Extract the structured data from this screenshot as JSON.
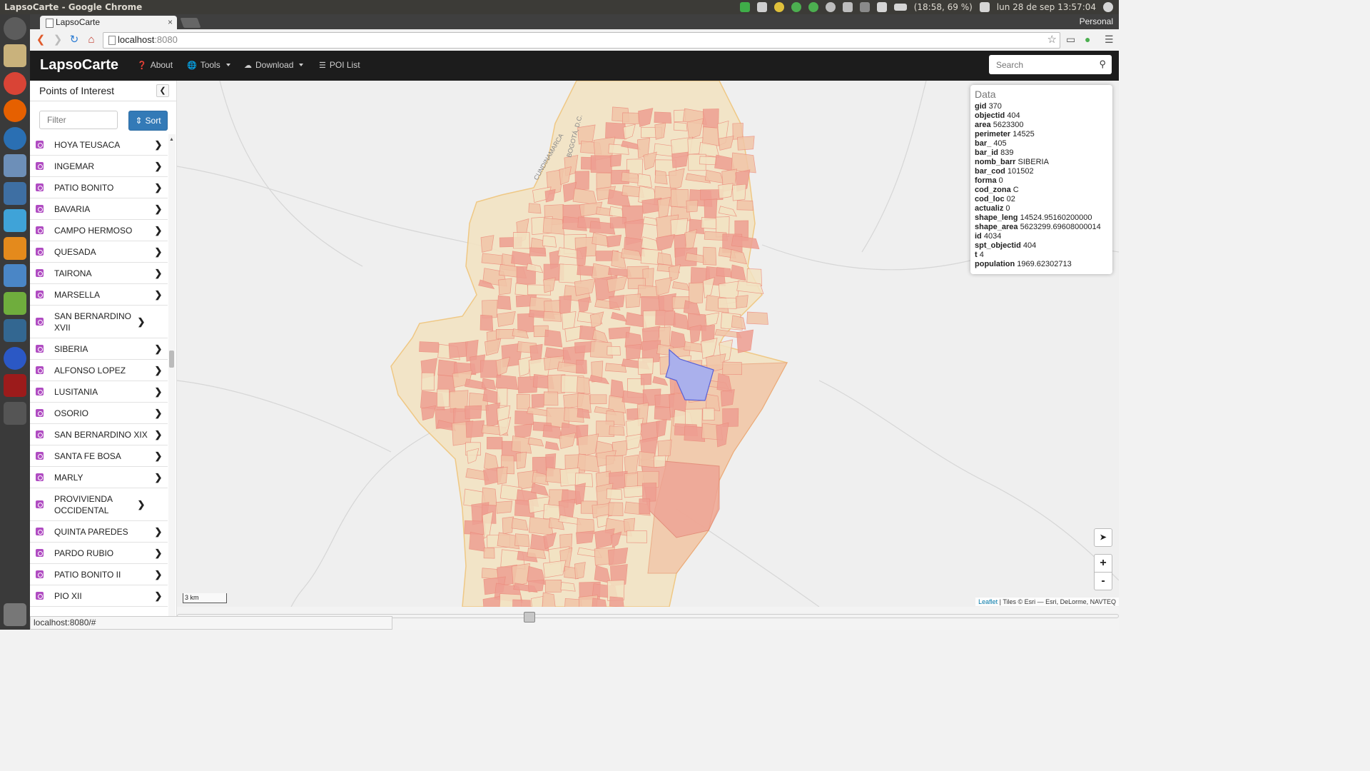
{
  "os": {
    "window_title": "LapsoCarte - Google Chrome",
    "battery": "(18:58, 69 %)",
    "clock": "lun 28 de sep 13:57:04",
    "profile": "Personal"
  },
  "browser": {
    "tab_title": "LapsoCarte",
    "tab_close": "×",
    "url_host": "localhost",
    "url_port": ":8080",
    "status_url": "localhost:8080/#"
  },
  "navbar": {
    "brand": "LapsoCarte",
    "about": "About",
    "tools": "Tools",
    "download": "Download",
    "poi_list": "POI List",
    "search_placeholder": "Search"
  },
  "sidebar": {
    "title": "Points of Interest",
    "filter_placeholder": "Filter",
    "sort_label": "Sort",
    "items": [
      {
        "label": "HOYA TEUSACA"
      },
      {
        "label": "INGEMAR"
      },
      {
        "label": "PATIO BONITO"
      },
      {
        "label": "BAVARIA"
      },
      {
        "label": "CAMPO HERMOSO"
      },
      {
        "label": "QUESADA"
      },
      {
        "label": "TAIRONA"
      },
      {
        "label": "MARSELLA"
      },
      {
        "label": "SAN BERNARDINO XVII"
      },
      {
        "label": "SIBERIA"
      },
      {
        "label": "ALFONSO LOPEZ"
      },
      {
        "label": "LUSITANIA"
      },
      {
        "label": "OSORIO"
      },
      {
        "label": "SAN BERNARDINO XIX"
      },
      {
        "label": "SANTA FE BOSA"
      },
      {
        "label": "MARLY"
      },
      {
        "label": "PROVIVIENDA OCCIDENTAL"
      },
      {
        "label": "QUINTA PAREDES"
      },
      {
        "label": "PARDO RUBIO"
      },
      {
        "label": "PATIO BONITO II"
      },
      {
        "label": "PIO XII"
      }
    ]
  },
  "data_panel": {
    "title": "Data",
    "rows": [
      {
        "key": "gid",
        "value": "370"
      },
      {
        "key": "objectid",
        "value": "404"
      },
      {
        "key": "area",
        "value": "5623300"
      },
      {
        "key": "perimeter",
        "value": "14525"
      },
      {
        "key": "bar_",
        "value": "405"
      },
      {
        "key": "bar_id",
        "value": "839"
      },
      {
        "key": "nomb_barr",
        "value": "SIBERIA"
      },
      {
        "key": "bar_cod",
        "value": "101502"
      },
      {
        "key": "forma",
        "value": "0"
      },
      {
        "key": "cod_zona",
        "value": "C"
      },
      {
        "key": "cod_loc",
        "value": "02"
      },
      {
        "key": "actualiz",
        "value": "0"
      },
      {
        "key": "shape_leng",
        "value": "14524.95160200000"
      },
      {
        "key": "shape_area",
        "value": "5623299.69608000014"
      },
      {
        "key": "id",
        "value": "4034"
      },
      {
        "key": "spt_objectid",
        "value": "404"
      },
      {
        "key": "t",
        "value": "4"
      },
      {
        "key": "population",
        "value": "1969.62302713"
      }
    ]
  },
  "map": {
    "labels": {
      "dept": "CUNDINAMARCA",
      "city": "BOGOTÁ, D.C."
    },
    "scale": "3 km",
    "attribution_link": "Leaflet",
    "attribution_rest": " | Tiles © Esri — Esri, DeLorme, NAVTEQ",
    "zoom_in": "+",
    "zoom_out": "-",
    "locate": "➤",
    "colors": {
      "fill_light": "#f3e3c3",
      "fill_mid": "#f1c5a8",
      "fill_dark": "#ee9f92",
      "highlight": "#aab0ec"
    }
  }
}
